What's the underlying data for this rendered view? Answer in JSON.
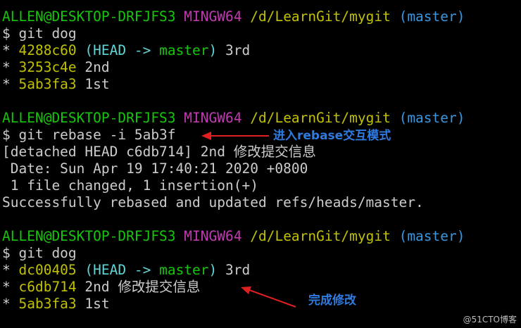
{
  "prompt": {
    "user": "ALLEN@DESKTOP-DRFJFS3",
    "shell": "MINGW64",
    "path": "/d/LearnGit/mygit",
    "branch": "(master)"
  },
  "block1": {
    "command": "$ git dog",
    "commits": [
      {
        "marker": "* ",
        "hash": "4288c60",
        "ref": "(HEAD -> master)",
        "msg": " 3rd"
      },
      {
        "marker": "* ",
        "hash": "3253c4e",
        "msg": " 2nd"
      },
      {
        "marker": "* ",
        "hash": "5ab3fa3",
        "msg": " 1st"
      }
    ]
  },
  "block2": {
    "command": "$ git rebase -i 5ab3f",
    "output": [
      "[detached HEAD c6db714] 2nd 修改提交信息",
      " Date: Sun Apr 19 17:40:21 2020 +0800",
      " 1 file changed, 1 insertion(+)",
      "Successfully rebased and updated refs/heads/master."
    ]
  },
  "block3": {
    "command": "$ git dog",
    "commits": [
      {
        "marker": "* ",
        "hash": "dc00405",
        "ref": "(HEAD -> master)",
        "msg": " 3rd"
      },
      {
        "marker": "* ",
        "hash": "c6db714",
        "msg": " 2nd 修改提交信息"
      },
      {
        "marker": "* ",
        "hash": "5ab3fa3",
        "msg": " 1st"
      }
    ]
  },
  "annotations": {
    "rebase_note": "进入rebase交互模式",
    "done_note": "完成修改"
  },
  "watermark": "@51CTO博客",
  "colors": {
    "user": "#16c60c",
    "shell": "#c239b3",
    "path": "#c1c104",
    "branch": "#3a96dd",
    "hash": "#c1c104",
    "ref_paren": "#61d6d6",
    "ref_branch": "#16c60c",
    "annotation": "#2f7be0",
    "arrow": "#e02020"
  }
}
